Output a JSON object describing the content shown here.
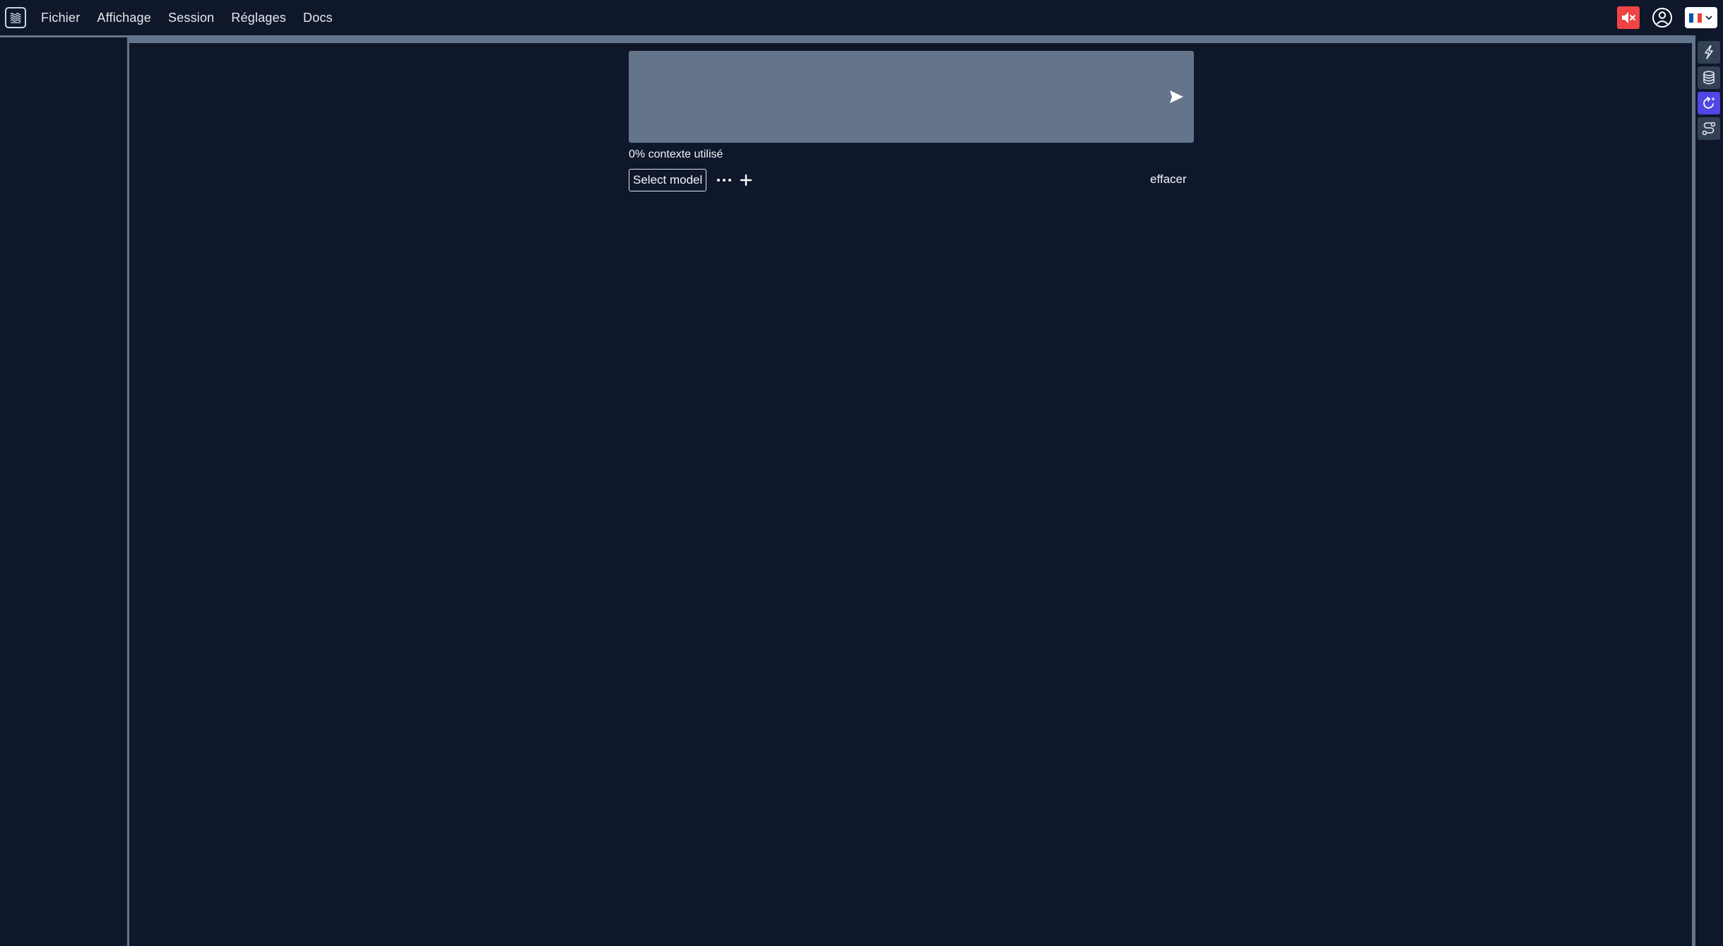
{
  "menubar": {
    "logo_icon": "app-logo-icon",
    "items": [
      {
        "label": "Fichier"
      },
      {
        "label": "Affichage"
      },
      {
        "label": "Session"
      },
      {
        "label": "Réglages"
      },
      {
        "label": "Docs"
      }
    ],
    "mute_icon": "speaker-muted-icon",
    "mute_color": "#ef4444",
    "user_icon": "user-circle-icon",
    "language": {
      "flag_icon": "france-flag-icon",
      "flag_colors": [
        "#0055a4",
        "#ffffff",
        "#ef4135"
      ],
      "dropdown_icon": "chevron-down-icon"
    }
  },
  "chat": {
    "input_value": "",
    "send_icon": "send-icon",
    "context_usage": "0% contexte utilisé",
    "model_select_label": "Select model",
    "more_icon": "ellipsis-icon",
    "add_icon": "plus-icon",
    "clear_label": "effacer"
  },
  "right_toolbar": {
    "tools": [
      {
        "icon": "lightning-icon",
        "active": false
      },
      {
        "icon": "database-icon",
        "active": false
      },
      {
        "icon": "refresh-sparkle-icon",
        "active": true
      },
      {
        "icon": "route-icon",
        "active": false
      }
    ],
    "active_color": "#4f46e5"
  },
  "colors": {
    "background": "#0f172a",
    "panel_border": "#64748b",
    "input_bg": "#64748b"
  }
}
